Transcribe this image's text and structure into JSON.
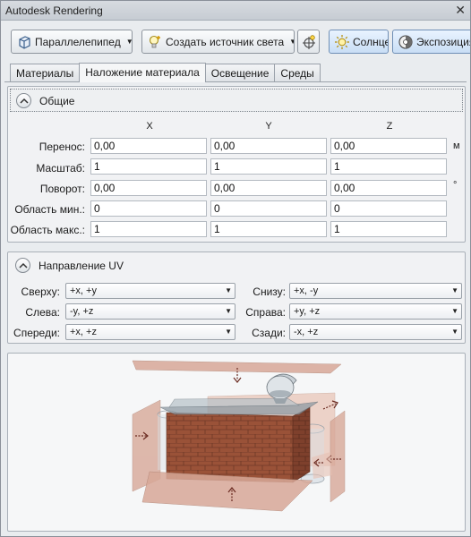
{
  "window": {
    "title": "Autodesk Rendering"
  },
  "toolbar": {
    "mapping_type": "Параллелепипед",
    "create_light": "Создать источник света",
    "sun": "Солнце",
    "exposure": "Экспозиция"
  },
  "tabs": [
    "Материалы",
    "Наложение материала",
    "Освещение",
    "Среды"
  ],
  "general": {
    "title": "Общие",
    "headers": [
      "X",
      "Y",
      "Z"
    ],
    "rows": [
      {
        "label": "Перенос:",
        "values": [
          "0,00",
          "0,00",
          "0,00"
        ],
        "unit": "м"
      },
      {
        "label": "Масштаб:",
        "values": [
          "1",
          "1",
          "1"
        ],
        "unit": ""
      },
      {
        "label": "Поворот:",
        "values": [
          "0,00",
          "0,00",
          "0,00"
        ],
        "unit": "°"
      },
      {
        "label": "Область мин.:",
        "values": [
          "0",
          "0",
          "0"
        ],
        "unit": ""
      },
      {
        "label": "Область макс.:",
        "values": [
          "1",
          "1",
          "1"
        ],
        "unit": ""
      }
    ]
  },
  "uv": {
    "title": "Направление UV",
    "items": [
      {
        "label": "Сверху:",
        "value": "+x, +y"
      },
      {
        "label": "Снизу:",
        "value": "+x, -y"
      },
      {
        "label": "Слева:",
        "value": "-y, +z"
      },
      {
        "label": "Справа:",
        "value": "+y, +z"
      },
      {
        "label": "Спереди:",
        "value": "+x, +z"
      },
      {
        "label": "Сзади:",
        "value": "-x, +z"
      }
    ]
  },
  "colors": {
    "accent": "#3c7fd1",
    "brick": "#9a5238",
    "plane": "#d8a898"
  }
}
